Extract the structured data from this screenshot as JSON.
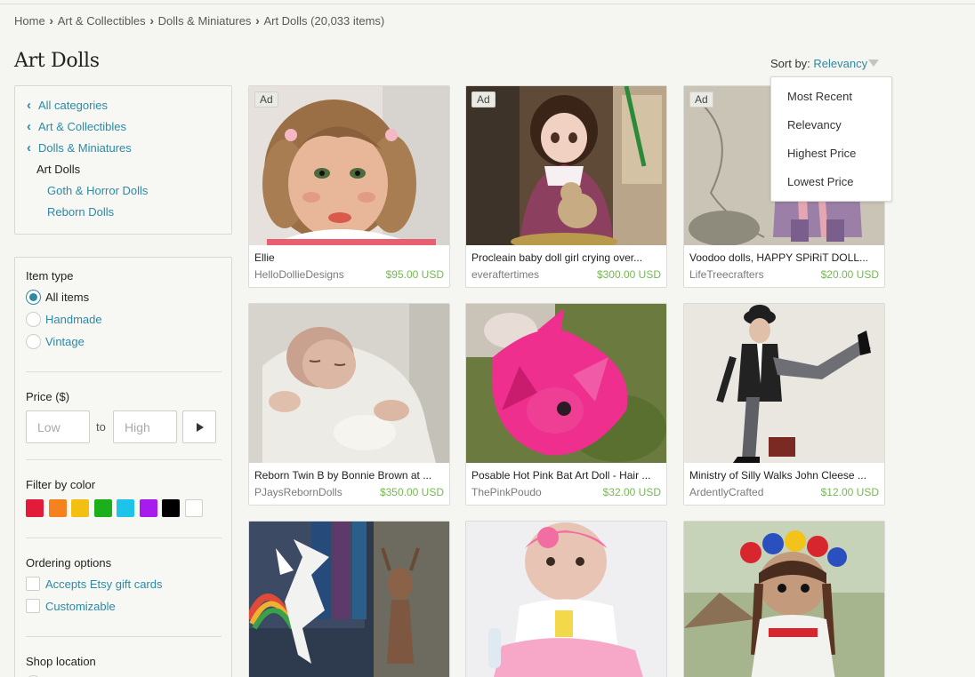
{
  "breadcrumb": {
    "items": [
      "Home",
      "Art & Collectibles",
      "Dolls & Miniatures",
      "Art Dolls (20,033 items)"
    ]
  },
  "page_title": "Art Dolls",
  "sort": {
    "label": "Sort by:",
    "value": "Relevancy",
    "options": [
      "Most Recent",
      "Relevancy",
      "Highest Price",
      "Lowest Price"
    ]
  },
  "categories": {
    "back_links": [
      "All categories",
      "Art & Collectibles",
      "Dolls & Miniatures"
    ],
    "current": "Art Dolls",
    "children": [
      "Goth & Horror Dolls",
      "Reborn Dolls"
    ]
  },
  "filters": {
    "item_type": {
      "heading": "Item type",
      "options": [
        "All items",
        "Handmade",
        "Vintage"
      ],
      "selected": "All items"
    },
    "price": {
      "heading": "Price ($)",
      "low_placeholder": "Low",
      "to_label": "to",
      "high_placeholder": "High"
    },
    "color": {
      "heading": "Filter by color",
      "swatches": [
        "#e31b3b",
        "#f5821f",
        "#f3c011",
        "#1bb01b",
        "#1ec3ea",
        "#a81bef",
        "#000000",
        "#ffffff"
      ]
    },
    "ordering": {
      "heading": "Ordering options",
      "options": [
        "Accepts Etsy gift cards",
        "Customizable"
      ]
    },
    "shop_location": {
      "heading": "Shop location"
    }
  },
  "ad_label": "Ad",
  "listings": [
    {
      "title": "Ellie",
      "shop": "HelloDollieDesigns",
      "price": "$95.00 USD",
      "ad": true,
      "image": "porcelain-doll-face"
    },
    {
      "title": "Procleain baby doll girl crying over...",
      "shop": "everaftertimes",
      "price": "$300.00 USD",
      "ad": true,
      "image": "baby-doll-with-teddy"
    },
    {
      "title": "Voodoo dolls, HAPPY SPiRiT DOLL...",
      "shop": "LifeTreecrafters",
      "price": "$20.00 USD",
      "ad": true,
      "image": "voodoo-dolls"
    },
    {
      "title": "Reborn Twin B by Bonnie Brown at ...",
      "shop": "PJaysRebornDolls",
      "price": "$350.00 USD",
      "ad": false,
      "image": "reborn-baby"
    },
    {
      "title": "Posable Hot Pink Bat Art Doll - Hair ...",
      "shop": "ThePinkPoudo",
      "price": "$32.00 USD",
      "ad": false,
      "image": "pink-bat-doll"
    },
    {
      "title": "Ministry of Silly Walks John Cleese ...",
      "shop": "ArdentlyCrafted",
      "price": "$12.00 USD",
      "ad": false,
      "image": "silly-walks-figure"
    },
    {
      "title": "",
      "shop": "",
      "price": "",
      "ad": false,
      "image": "white-dragon-figures"
    },
    {
      "title": "",
      "shop": "",
      "price": "",
      "ad": false,
      "image": "reborn-baby-pink-dress"
    },
    {
      "title": "",
      "shop": "",
      "price": "",
      "ad": false,
      "image": "crochet-doll-flower-crown"
    }
  ]
}
